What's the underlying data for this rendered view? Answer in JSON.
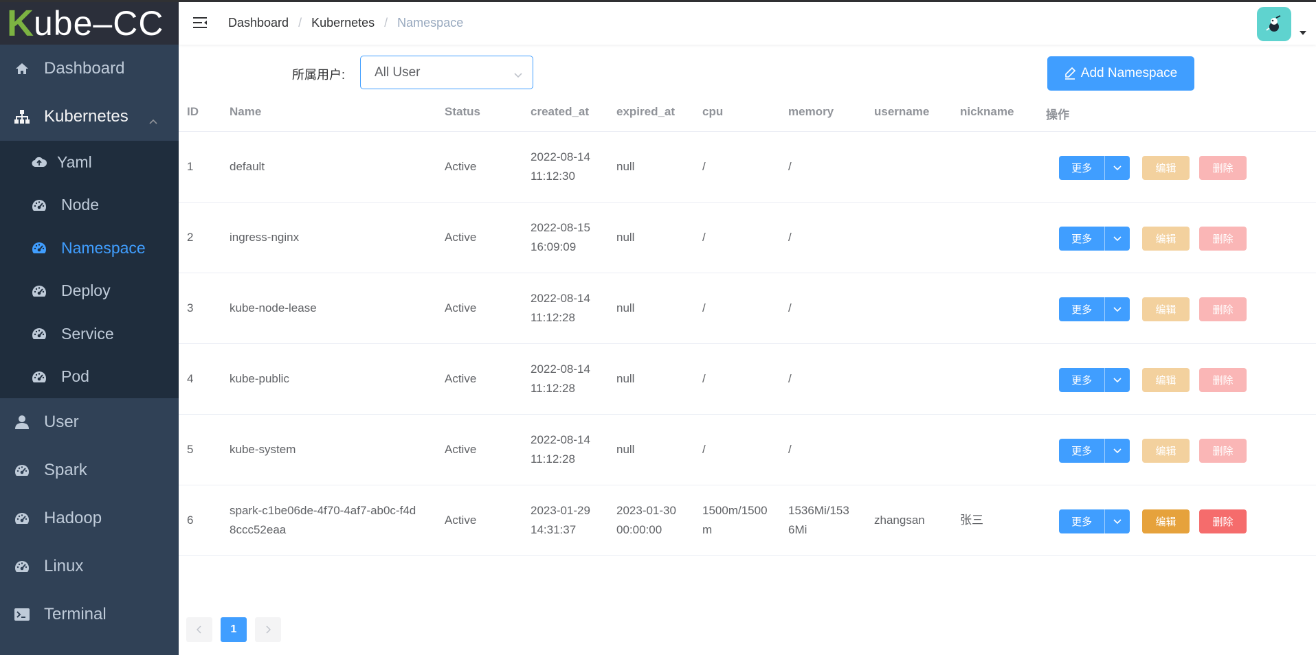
{
  "logo": {
    "k": "K",
    "rest": "ube–CC"
  },
  "sidebar": {
    "items": [
      {
        "label": "Dashboard",
        "icon": "home-icon"
      },
      {
        "label": "Kubernetes",
        "icon": "sitemap-icon",
        "expanded": true,
        "children": [
          {
            "label": "Yaml",
            "icon": "cloud-upload-icon"
          },
          {
            "label": "Node",
            "icon": "dashboard-icon"
          },
          {
            "label": "Namespace",
            "icon": "dashboard-icon",
            "active": true
          },
          {
            "label": "Deploy",
            "icon": "dashboard-icon"
          },
          {
            "label": "Service",
            "icon": "dashboard-icon"
          },
          {
            "label": "Pod",
            "icon": "dashboard-icon"
          }
        ]
      },
      {
        "label": "User",
        "icon": "user-icon"
      },
      {
        "label": "Spark",
        "icon": "dashboard-icon"
      },
      {
        "label": "Hadoop",
        "icon": "dashboard-icon"
      },
      {
        "label": "Linux",
        "icon": "dashboard-icon"
      },
      {
        "label": "Terminal",
        "icon": "terminal-icon"
      }
    ]
  },
  "header": {
    "breadcrumb": [
      "Dashboard",
      "Kubernetes",
      "Namespace"
    ]
  },
  "filter": {
    "label": "所属用户:",
    "select_value": "All User"
  },
  "add_button": "Add Namespace",
  "table": {
    "headers": [
      "ID",
      "Name",
      "Status",
      "created_at",
      "expired_at",
      "cpu",
      "memory",
      "username",
      "nickname",
      "操作"
    ],
    "rows": [
      {
        "id": "1",
        "name": "default",
        "status": "Active",
        "created_date": "2022-08-14",
        "created_time": "11:12:30",
        "expired": "null",
        "cpu": "/",
        "memory": "/",
        "username": "",
        "nickname": "",
        "enabled": false
      },
      {
        "id": "2",
        "name": "ingress-nginx",
        "status": "Active",
        "created_date": "2022-08-15",
        "created_time": "16:09:09",
        "expired": "null",
        "cpu": "/",
        "memory": "/",
        "username": "",
        "nickname": "",
        "enabled": false
      },
      {
        "id": "3",
        "name": "kube-node-lease",
        "status": "Active",
        "created_date": "2022-08-14",
        "created_time": "11:12:28",
        "expired": "null",
        "cpu": "/",
        "memory": "/",
        "username": "",
        "nickname": "",
        "enabled": false
      },
      {
        "id": "4",
        "name": "kube-public",
        "status": "Active",
        "created_date": "2022-08-14",
        "created_time": "11:12:28",
        "expired": "null",
        "cpu": "/",
        "memory": "/",
        "username": "",
        "nickname": "",
        "enabled": false
      },
      {
        "id": "5",
        "name": "kube-system",
        "status": "Active",
        "created_date": "2022-08-14",
        "created_time": "11:12:28",
        "expired": "null",
        "cpu": "/",
        "memory": "/",
        "username": "",
        "nickname": "",
        "enabled": false
      },
      {
        "id": "6",
        "name_line1": "spark-c1be06de-4f70-4af7-ab0c-f4d",
        "name_line2": "8ccc52eaa",
        "status": "Active",
        "created_date": "2023-01-29",
        "created_time": "14:31:37",
        "expired_date": "2023-01-30",
        "expired_time": "00:00:00",
        "cpu_line1": "1500m/1500",
        "cpu_line2": "m",
        "memory_line1": "1536Mi/153",
        "memory_line2": "6Mi",
        "username": "zhangsan",
        "nickname": "张三",
        "enabled": true
      }
    ],
    "action_labels": {
      "more": "更多",
      "edit": "编辑",
      "delete": "删除"
    }
  },
  "pagination": {
    "current": "1"
  },
  "colors": {
    "primary": "#409eff",
    "sidebar": "#304156",
    "submenu": "#1f2d3d",
    "warning": "#e6a23c",
    "danger": "#f56c6c"
  }
}
